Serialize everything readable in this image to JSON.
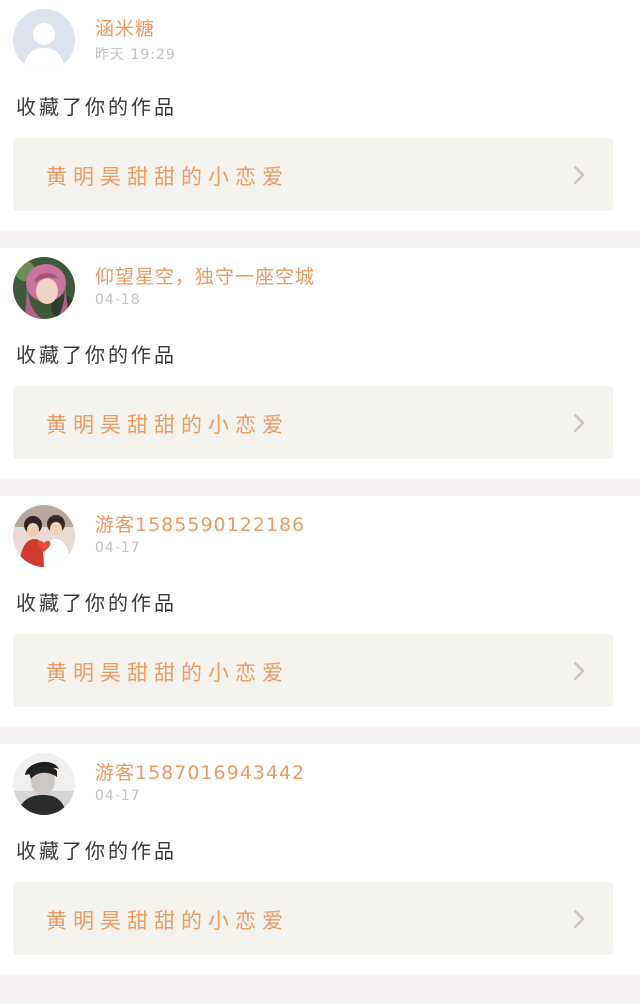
{
  "notifications": [
    {
      "username": "涵米糖",
      "time": "昨天 19:29",
      "action": "收藏了你的作品",
      "work_title": "黄明昊甜甜的小恋爱",
      "avatar": "default-user-avatar"
    },
    {
      "username": "仰望星空，独守一座空城",
      "time": "04-18",
      "action": "收藏了你的作品",
      "work_title": "黄明昊甜甜的小恋爱",
      "avatar": "pink-hair-girl-avatar"
    },
    {
      "username": "游客1585590122186",
      "time": "04-17",
      "action": "收藏了你的作品",
      "work_title": "黄明昊甜甜的小恋爱",
      "avatar": "couple-heart-avatar"
    },
    {
      "username": "游客1587016943442",
      "time": "04-17",
      "action": "收藏了你的作品",
      "work_title": "黄明昊甜甜的小恋爱",
      "avatar": "dark-hair-boy-avatar"
    }
  ],
  "colors": {
    "accent": "#ee9a63",
    "card_bg": "#ffffff",
    "link_bg": "#f4f3ee",
    "separator": "#f7f3f2",
    "timestamp": "#c6c0bd",
    "chevron": "#c9c6c2"
  }
}
